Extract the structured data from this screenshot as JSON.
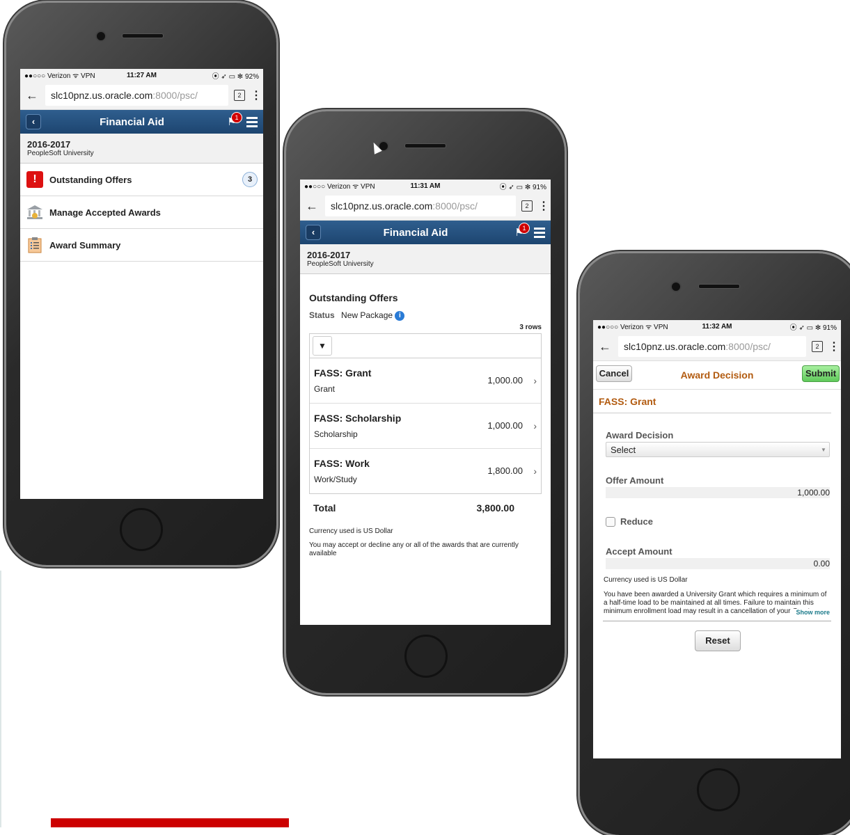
{
  "status_bar": {
    "carrier": "●●○○○ Verizon ᯤ VPN",
    "phone1": {
      "time": "11:27 AM",
      "right": "⦿ ➶ ▭ ✻ 92%"
    },
    "phone2": {
      "time": "11:31 AM",
      "right": "⦿ ➶ ▭ ✻ 91%"
    },
    "phone3": {
      "time": "11:32 AM",
      "right": "⦿ ➶ ▭ ✻ 91%"
    }
  },
  "browser": {
    "url_main": "slc10pnz.us.oracle.com",
    "url_rest": ":8000/psc/",
    "tabs_count": "2"
  },
  "app": {
    "title": "Financial Aid",
    "flag_count": "1",
    "year": "2016-2017",
    "university": "PeopleSoft University"
  },
  "menu": {
    "items": [
      {
        "label": "Outstanding Offers",
        "count": "3"
      },
      {
        "label": "Manage Accepted Awards"
      },
      {
        "label": "Award Summary"
      }
    ]
  },
  "offers": {
    "heading": "Outstanding Offers",
    "status_label": "Status",
    "status_value": "New Package",
    "rows_count": "3 rows",
    "rows": [
      {
        "name": "FASS:  Grant",
        "type": "Grant",
        "amount": "1,000.00"
      },
      {
        "name": "FASS:  Scholarship",
        "type": "Scholarship",
        "amount": "1,000.00"
      },
      {
        "name": "FASS:  Work",
        "type": "Work/Study",
        "amount": "1,800.00"
      }
    ],
    "total_label": "Total",
    "total_value": "3,800.00",
    "currency_note": "Currency used is US Dollar",
    "accept_note": "You may accept or decline any or all of the awards that are currently available"
  },
  "decision": {
    "cancel": "Cancel",
    "title": "Award Decision",
    "submit": "Submit",
    "award_name": "FASS: Grant",
    "award_decision_label": "Award Decision",
    "select_value": "Select",
    "offer_amount_label": "Offer Amount",
    "offer_amount": "1,000.00",
    "reduce_label": "Reduce",
    "accept_amount_label": "Accept Amount",
    "accept_amount": "0.00",
    "currency_note": "Currency used is US Dollar",
    "message": "You have been awarded a University Grant which requires a minimum of a half-time load to be maintained at all times. Failure to maintain this minimum enrollment load may result in a cancellation of your Grant.",
    "show_more": "Show more",
    "reset": "Reset"
  },
  "colors": {
    "app_bar": "#1d4570",
    "accent_red": "#cc0000",
    "decision_title": "#b25b10",
    "submit_green": "#6fcf6a"
  }
}
